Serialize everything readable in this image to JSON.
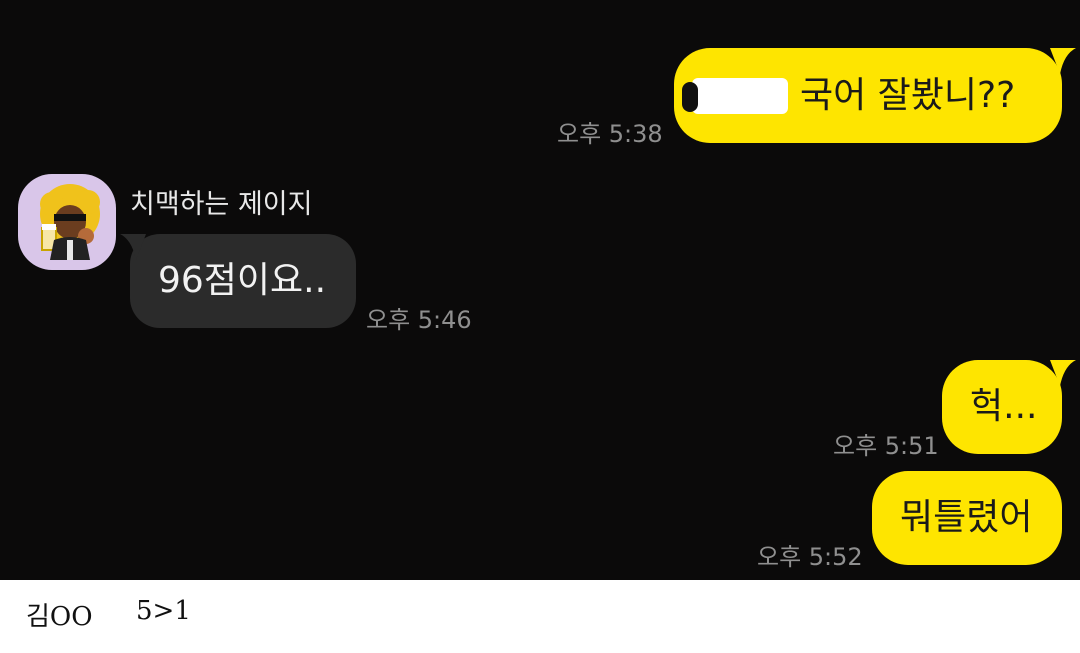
{
  "messages": [
    {
      "sender": "me",
      "text": "국어 잘봤니??",
      "time": "오후 5:38",
      "redacted_prefix": true
    },
    {
      "sender": "other",
      "name": "치맥하는 제이지",
      "text": "96점이요..",
      "time": "오후 5:46"
    },
    {
      "sender": "me",
      "text": "헉...",
      "time": "오후 5:51"
    },
    {
      "sender": "me",
      "text": "뭐틀렸어",
      "time": "오후 5:52"
    }
  ],
  "contact": {
    "name": "치맥하는 제이지",
    "avatar_icon": "afro-character-beer-icon"
  },
  "footer": {
    "name": "김OO",
    "score": "5>1"
  },
  "colors": {
    "background": "#0b0a0a",
    "my_bubble": "#fee500",
    "their_bubble": "#2b2b2b",
    "timestamp": "#8f8f8f"
  }
}
